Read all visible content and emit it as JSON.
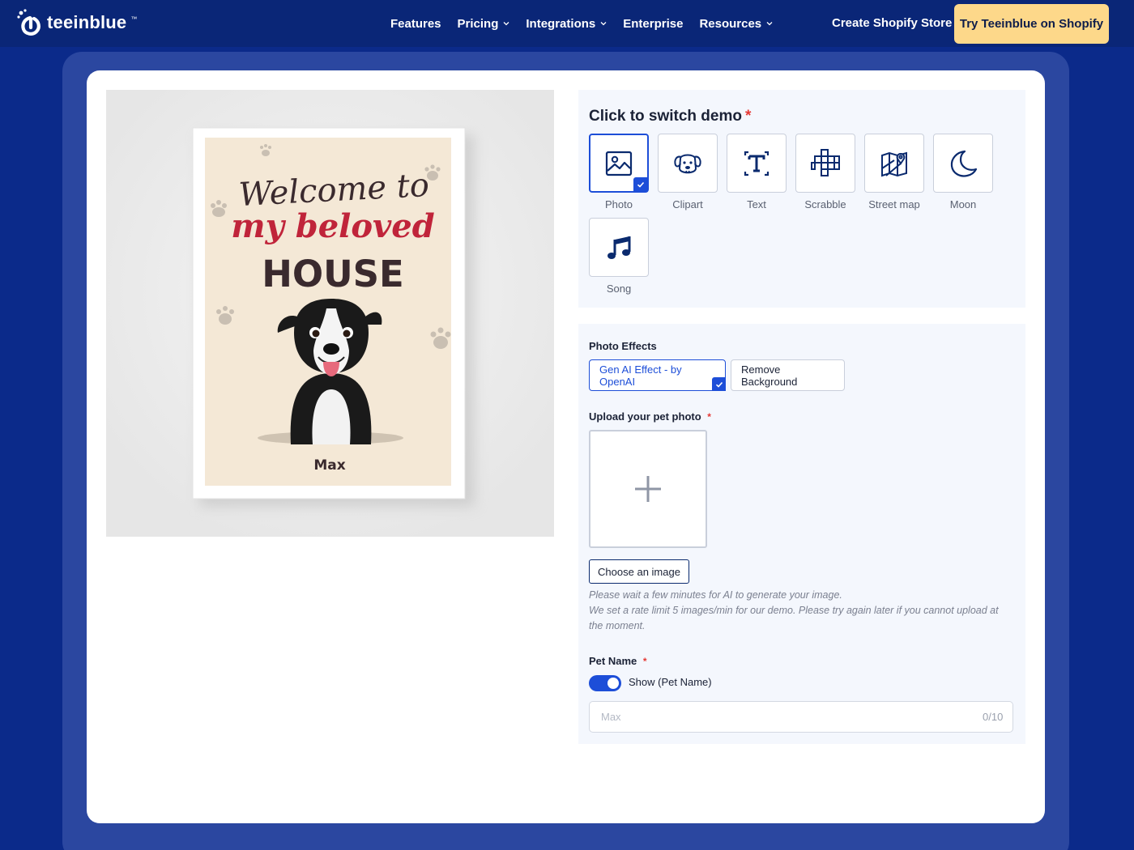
{
  "nav": {
    "brand": "teeinblue",
    "brand_tm": "™",
    "links": [
      {
        "label": "Features",
        "dropdown": false
      },
      {
        "label": "Pricing",
        "dropdown": true
      },
      {
        "label": "Integrations",
        "dropdown": true
      },
      {
        "label": "Enterprise",
        "dropdown": false
      },
      {
        "label": "Resources",
        "dropdown": true
      }
    ],
    "store_link": "Create Shopify Store",
    "cta": "Try Teeinblue on Shopify"
  },
  "preview": {
    "line1": "Welcome to",
    "line2": "my beloved",
    "line3": "HOUSE",
    "pet_name": "Max"
  },
  "demo": {
    "title": "Click to switch demo",
    "required_mark": "*",
    "selected": "photo",
    "items": [
      {
        "id": "photo",
        "label": "Photo",
        "icon": "photo-icon"
      },
      {
        "id": "clipart",
        "label": "Clipart",
        "icon": "dog-clipart-icon"
      },
      {
        "id": "text",
        "label": "Text",
        "icon": "text-icon"
      },
      {
        "id": "scrabble",
        "label": "Scrabble",
        "icon": "scrabble-icon"
      },
      {
        "id": "street-map",
        "label": "Street map",
        "icon": "map-icon"
      },
      {
        "id": "moon",
        "label": "Moon",
        "icon": "moon-icon"
      },
      {
        "id": "song",
        "label": "Song",
        "icon": "music-note-icon"
      }
    ]
  },
  "effects": {
    "label": "Photo Effects",
    "options": [
      {
        "label": "Gen AI Effect - by OpenAI",
        "selected": true
      },
      {
        "label": "Remove Background",
        "selected": false
      }
    ]
  },
  "upload": {
    "label": "Upload your pet photo",
    "required_mark": "*",
    "button": "Choose an image",
    "note_line1": "Please wait a few minutes for AI to generate your image.",
    "note_line2": "We set a rate limit 5 images/min for our demo. Please try again later if you cannot upload at the moment."
  },
  "pet_name": {
    "label": "Pet Name",
    "required_mark": "*",
    "toggle_label": "Show (Pet Name)",
    "toggle_on": true,
    "placeholder": "Max",
    "value": "",
    "counter": "0/10"
  },
  "colors": {
    "nav_bg": "#0a2677",
    "page_bg": "#0b2a8a",
    "accent": "#1d4ed8",
    "cta_bg": "#fdd88a",
    "poster_red": "#c0243a",
    "poster_dark": "#3a2a2e"
  }
}
